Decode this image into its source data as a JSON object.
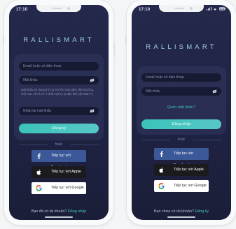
{
  "left_screen": {
    "time": "17:10",
    "brand": "RALLISMART",
    "fields": {
      "email_placeholder": "Email hoặc số điện thoại",
      "password_placeholder": "Mật khẩu",
      "confirm_placeholder": "Nhập lại mật khẩu"
    },
    "password_hint": "Mật khẩu sử dụng 8 ký tự trở lên, bao gồm chữ thường, chữ hoa, số và có ít nhất một ký tự đặc biệt (@%$&*#-)",
    "register_button": "Đăng ký",
    "divider": "hoặc",
    "social": {
      "facebook": "Tiếp tục với Facebook",
      "apple": "Tiếp tục với Apple",
      "google": "Tiếp tục với Google"
    },
    "footer_prefix": "Bạn đã có tài khoản?",
    "footer_link": "Đăng nhập"
  },
  "right_screen": {
    "time": "17:10",
    "brand": "RALLISMART",
    "fields": {
      "email_placeholder": "Email hoặc số điện thoại",
      "password_placeholder": "Mật khẩu"
    },
    "forgot_link": "Quên mật khẩu?",
    "login_button": "Đăng nhập",
    "divider": "hoặc",
    "social": {
      "facebook": "Tiếp tục với Facebook",
      "apple": "Tiếp tục với Apple",
      "google": "Tiếp tục với Google"
    },
    "footer_prefix": "Bạn chưa có tài khoản?",
    "footer_link": "Đăng ký"
  },
  "colors": {
    "background": "#1f2343",
    "accent": "#3fc3b7",
    "facebook": "#3b5998",
    "apple": "#1b1b1f",
    "google": "#ffffff"
  },
  "icons": [
    "facebook-icon",
    "apple-icon",
    "google-icon",
    "eye-slash-icon",
    "signal-icon",
    "wifi-icon",
    "battery-icon"
  ]
}
